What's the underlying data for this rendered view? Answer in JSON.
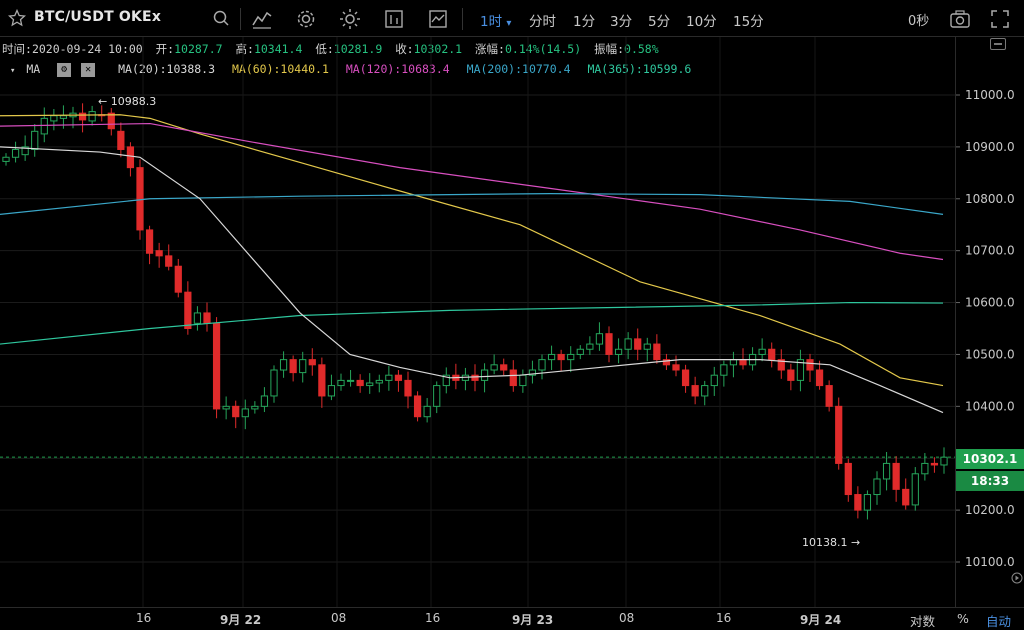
{
  "toolbar": {
    "symbol": "BTC/USDT OKEx",
    "timeframes": [
      "1时",
      "分时",
      "1分",
      "3分",
      "5分",
      "10分",
      "15分"
    ],
    "active_timeframe": "1时",
    "countdown": "0秒"
  },
  "info": {
    "time_label": "时间:",
    "time": "2020-09-24 10:00",
    "open_label": "开:",
    "open": "10287.7",
    "high_label": "高:",
    "high": "10341.4",
    "low_label": "低:",
    "low": "10281.9",
    "close_label": "收:",
    "close": "10302.1",
    "change_label": "涨幅:",
    "change": "0.14%(14.5)",
    "amp_label": "振幅:",
    "amp": "0.58%"
  },
  "ma": {
    "label": "MA",
    "items": [
      {
        "text": "MA(20):10388.3",
        "color": "#d8d8d8"
      },
      {
        "text": "MA(60):10440.1",
        "color": "#e3c84b"
      },
      {
        "text": "MA(120):10683.4",
        "color": "#d84fc0"
      },
      {
        "text": "MA(200):10770.4",
        "color": "#3aa7c9"
      },
      {
        "text": "MA(365):10599.6",
        "color": "#2fc79e"
      }
    ]
  },
  "price_axis": {
    "ticks": [
      "11000.0",
      "10900.0",
      "10800.0",
      "10700.0",
      "10600.0",
      "10500.0",
      "10400.0",
      "10300.0",
      "10200.0",
      "10100.0"
    ],
    "last_price": "10302.1",
    "timer": "18:33"
  },
  "annotations": {
    "high_mark": "10988.3",
    "low_mark": "10138.1"
  },
  "time_axis": {
    "labels": [
      "16",
      "9月 22",
      "08",
      "16",
      "9月 23",
      "08",
      "16",
      "9月 24",
      "对数",
      "%",
      "自动"
    ]
  },
  "colors": {
    "up": "#26a65b",
    "down": "#e02b2b",
    "accent": "#4a90e2",
    "price_tag": "#1f9f4e"
  }
}
